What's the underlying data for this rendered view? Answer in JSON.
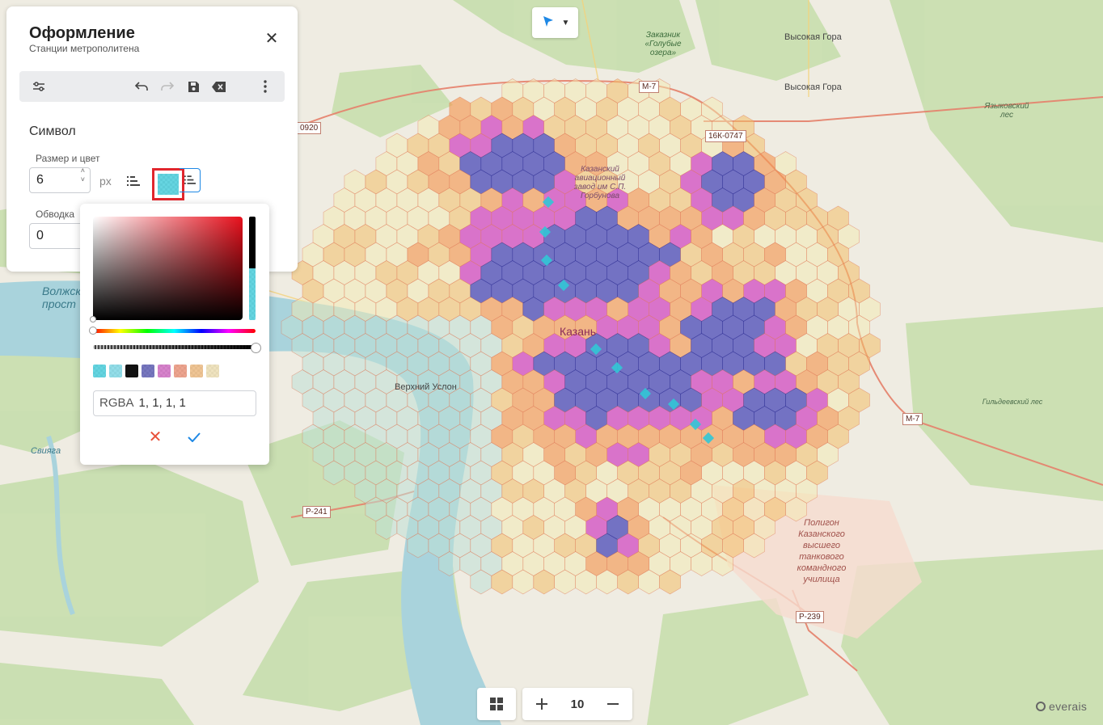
{
  "panel": {
    "title": "Оформление",
    "subtitle": "Станции метрополитена",
    "section_title": "Символ",
    "size_color_label": "Размер и цвет",
    "size_value": "6",
    "size_unit": "px",
    "stroke_label": "Обводка",
    "stroke_value": "0"
  },
  "color_picker": {
    "format_label": "RGBA",
    "value": "1, 1, 1, 1",
    "selected_swatch_color": "#32c6d6",
    "swatches": [
      "#32c6d6",
      "#6fd1e0",
      "#111111",
      "#4a4aa8",
      "#c85ab9",
      "#e5866a",
      "#e8b070",
      "#e8d8a8"
    ]
  },
  "map": {
    "city_label": "Казань",
    "places": {
      "vysokaya_gora_1": "Высокая Гора",
      "vysokaya_gora_2": "Высокая Гора",
      "zakaznik": "Заказник «Голубые озера»",
      "yazykovsky": "Языковский лес",
      "verkhny_uslon": "Верхний Услон",
      "gildeevsky": "Гильдеевский лес",
      "poligon": "Полигон Казанского высшего танкового командного училища",
      "aviazavod": "Казанский авиационный завод им С.П. Горбунова",
      "volga": "Волжско прост",
      "sviyaga": "Свияга"
    },
    "roads": {
      "m7_top": "М-7",
      "r16k": "16К-0747",
      "road0920": "0920",
      "m7_right": "М-7",
      "r241": "Р-241",
      "r239": "Р-239"
    }
  },
  "zoom": {
    "level": "10"
  },
  "brand": "everais",
  "colors": {
    "accent": "#1e88e5",
    "highlight_border": "#e1262d",
    "hex_blue": "#4a4ab8",
    "hex_magenta": "#d040c0",
    "hex_orange": "#f39a55",
    "hex_yellow": "#f2c068",
    "hex_pale": "#f4e9b0",
    "hex_teal": "#bde0d6"
  }
}
